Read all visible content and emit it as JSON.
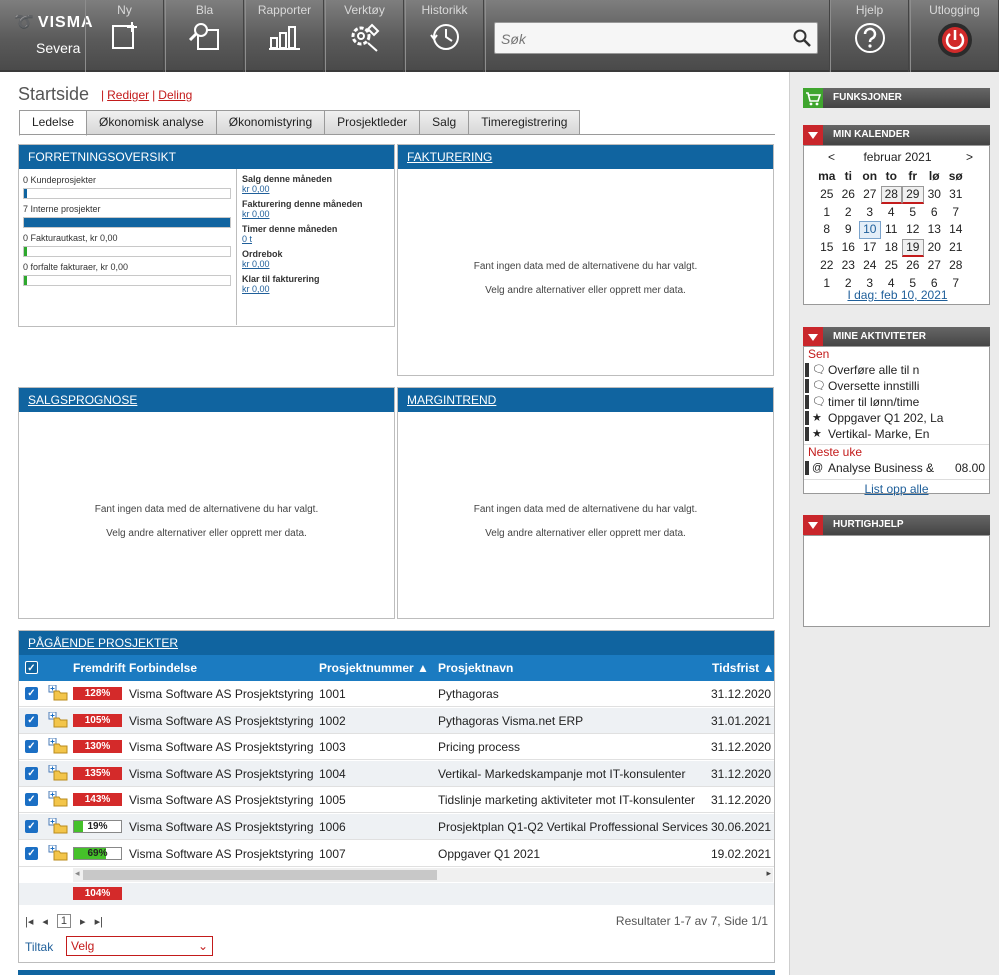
{
  "app": {
    "brand": "VISMA",
    "company": "Severa"
  },
  "nav": [
    {
      "label": "Ny",
      "icon": "new-icon"
    },
    {
      "label": "Bla",
      "icon": "browse-icon"
    },
    {
      "label": "Rapporter",
      "icon": "reports-icon"
    },
    {
      "label": "Verktøy",
      "icon": "tools-icon"
    },
    {
      "label": "Historikk",
      "icon": "history-icon"
    }
  ],
  "nav_right": [
    {
      "label": "Hjelp",
      "icon": "help-icon"
    },
    {
      "label": "Utlogging",
      "icon": "power-icon"
    }
  ],
  "search": {
    "placeholder": "Søk"
  },
  "page": {
    "title": "Startside",
    "edit_link": "Rediger",
    "share_link": "Deling"
  },
  "tabs": [
    "Ledelse",
    "Økonomisk analyse",
    "Økonomistyring",
    "Prosjektleder",
    "Salg",
    "Timeregistrering"
  ],
  "panels": {
    "forretning": {
      "title": "FORRETNINGSOVERSIKT",
      "items": [
        {
          "label": "0 Kundeprosjekter",
          "fill": 0.01
        },
        {
          "label": "7 Interne prosjekter",
          "fill": 1.0
        },
        {
          "label": "0 Fakturautkast, kr 0,00",
          "fill": 0.01
        },
        {
          "label": "0 forfalte fakturaer, kr 0,00",
          "fill": 0.01
        }
      ],
      "kpis": [
        {
          "label": "Salg denne måneden",
          "value": "kr 0,00"
        },
        {
          "label": "Fakturering denne måneden",
          "value": "kr 0,00"
        },
        {
          "label": "Timer denne måneden",
          "value": "0 t"
        },
        {
          "label": "Ordrebok",
          "value": "kr 0,00"
        },
        {
          "label": "Klar til fakturering",
          "value": "kr 0,00"
        }
      ]
    },
    "fakturering": {
      "title": "FAKTURERING"
    },
    "salgsprognose": {
      "title": "SALGSPROGNOSE"
    },
    "margintrend": {
      "title": "MARGINTREND"
    },
    "empty_line1": "Fant ingen data med de alternativene du har valgt.",
    "empty_line2": "Velg andre alternativer eller opprett mer data."
  },
  "projects": {
    "title": "PÅGÅENDE PROSJEKTER",
    "columns": [
      "Fremdrift",
      "Forbindelse",
      "Prosjektnummer",
      "Prosjektnavn",
      "Tidsfrist"
    ],
    "rows": [
      {
        "progress": "128%",
        "progress_value": 1.28,
        "customer": "Visma Software AS Prosjektstyring",
        "number": "1001",
        "name": "Pythagoras",
        "deadline": "31.12.2020"
      },
      {
        "progress": "105%",
        "progress_value": 1.05,
        "customer": "Visma Software AS Prosjektstyring",
        "number": "1002",
        "name": "Pythagoras Visma.net ERP",
        "deadline": "31.01.2021"
      },
      {
        "progress": "130%",
        "progress_value": 1.3,
        "customer": "Visma Software AS Prosjektstyring",
        "number": "1003",
        "name": "Pricing process",
        "deadline": "31.12.2020"
      },
      {
        "progress": "135%",
        "progress_value": 1.35,
        "customer": "Visma Software AS Prosjektstyring",
        "number": "1004",
        "name": "Vertikal- Markedskampanje mot IT-konsulenter",
        "deadline": "31.12.2020"
      },
      {
        "progress": "143%",
        "progress_value": 1.43,
        "customer": "Visma Software AS Prosjektstyring",
        "number": "1005",
        "name": "Tidslinje marketing aktiviteter mot IT-konsulenter",
        "deadline": "31.12.2020"
      },
      {
        "progress": "19%",
        "progress_value": 0.19,
        "customer": "Visma Software AS Prosjektstyring",
        "number": "1006",
        "name": "Prosjektplan Q1-Q2 Vertikal Proffessional Services",
        "deadline": "30.06.2021"
      },
      {
        "progress": "69%",
        "progress_value": 0.69,
        "customer": "Visma Software AS Prosjektstyring",
        "number": "1007",
        "name": "Oppgaver Q1 2021",
        "deadline": "19.02.2021"
      }
    ],
    "total_progress": "104%",
    "page": "1",
    "results": "Resultater 1-7 av 7, Side 1/1",
    "tiltak_label": "Tiltak",
    "tiltak_value": "Velg"
  },
  "sidebar": {
    "funksjoner": "FUNKSJONER",
    "calendar": {
      "title": "MIN KALENDER",
      "prev": "<",
      "next": ">",
      "month": "februar 2021",
      "weekdays": [
        "ma",
        "ti",
        "on",
        "to",
        "fr",
        "lø",
        "sø"
      ],
      "weeks": [
        [
          "25",
          "26",
          "27",
          "28",
          "29",
          "30",
          "31"
        ],
        [
          "1",
          "2",
          "3",
          "4",
          "5",
          "6",
          "7"
        ],
        [
          "8",
          "9",
          "10",
          "11",
          "12",
          "13",
          "14"
        ],
        [
          "15",
          "16",
          "17",
          "18",
          "19",
          "20",
          "21"
        ],
        [
          "22",
          "23",
          "24",
          "25",
          "26",
          "27",
          "28"
        ],
        [
          "1",
          "2",
          "3",
          "4",
          "5",
          "6",
          "7"
        ]
      ],
      "today_link": "I dag: feb 10, 2021"
    },
    "activities": {
      "title": "MINE AKTIVITETER",
      "late_label": "Sen",
      "late": [
        {
          "icon": "comment-icon",
          "text": "Overføre alle til n"
        },
        {
          "icon": "comment-icon",
          "text": "Oversette innstilli"
        },
        {
          "icon": "comment-icon",
          "text": "timer til lønn/time"
        },
        {
          "icon": "star-icon",
          "text": "Oppgaver Q1 202, La"
        },
        {
          "icon": "star-icon",
          "text": "Vertikal- Marke, En"
        }
      ],
      "next_label": "Neste uke",
      "next": [
        {
          "icon": "at-icon",
          "text": "Analyse Business &",
          "time": "08.00"
        }
      ],
      "list_all": "List opp alle"
    },
    "quickhelp": "HURTIGHJELP"
  }
}
